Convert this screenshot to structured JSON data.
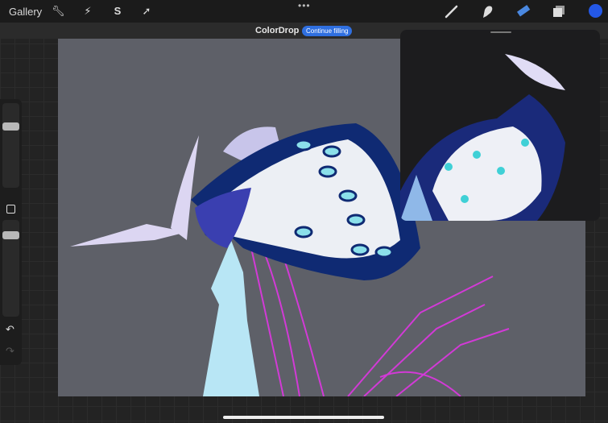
{
  "toolbar": {
    "gallery_label": "Gallery",
    "left_tools": [
      "wrench-icon",
      "magic-wand-icon",
      "selection-s-icon",
      "arrow-transform-icon"
    ],
    "more_label": "•••",
    "right_tools": [
      "brush-icon",
      "smudge-icon",
      "eraser-icon",
      "layers-icon"
    ],
    "active_tool": "eraser",
    "color": "#2458e6"
  },
  "colordrop": {
    "label": "ColorDrop",
    "button_label": "Continue filling"
  },
  "sidebar": {
    "undo": "↶",
    "redo": "↷"
  },
  "colors": {
    "canvas": "#5e6068",
    "accent": "#2f6fe0",
    "sketch": "#d23ad6"
  }
}
